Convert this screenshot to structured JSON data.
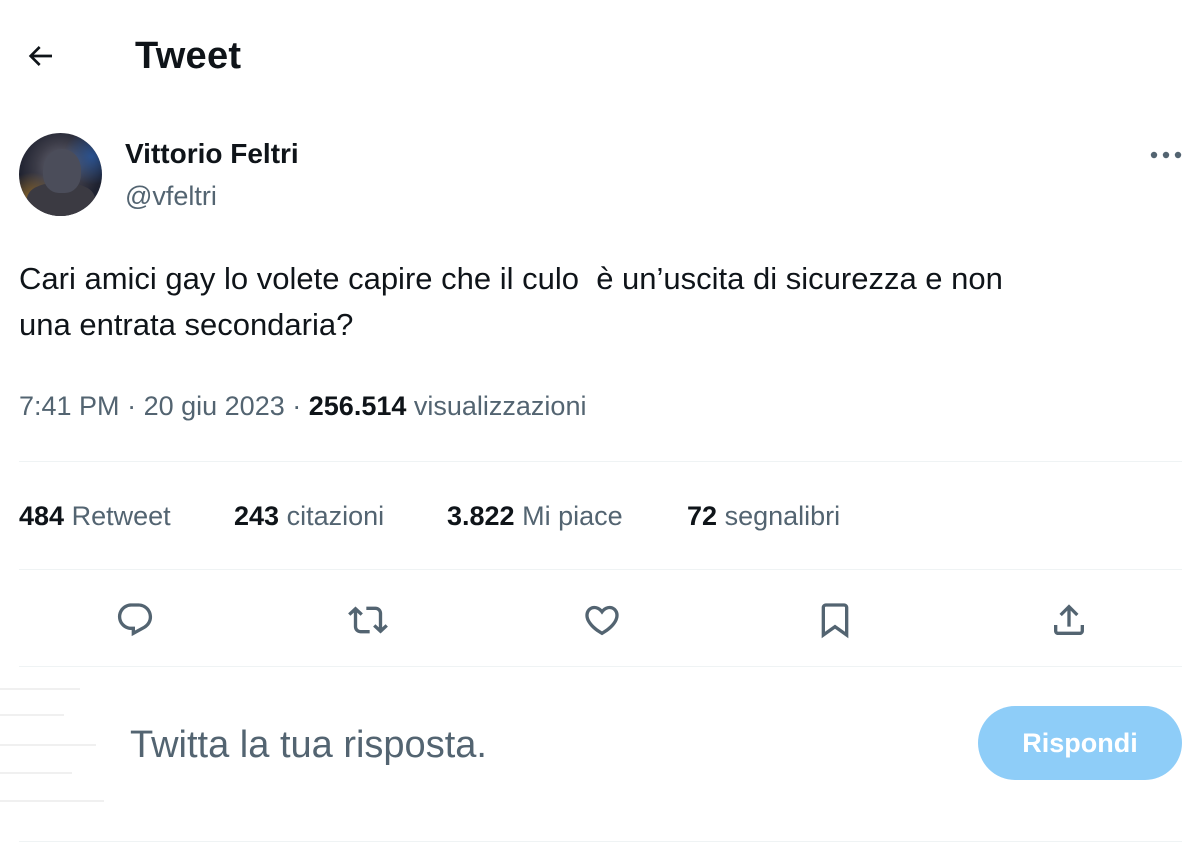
{
  "header": {
    "title": "Tweet",
    "back_icon": "arrow-left-icon"
  },
  "author": {
    "name": "Vittorio Feltri",
    "handle": "@vfeltri",
    "more_icon": "more-horizontal-icon"
  },
  "tweet": {
    "text": "Cari amici gay lo volete capire che il culo  è un’uscita di sicurezza e non\nuna entrata secondaria?",
    "time": "7:41 PM",
    "date": "20 giu 2023",
    "separator": "·",
    "views_count": "256.514",
    "views_label": "visualizzazioni"
  },
  "stats": [
    {
      "count": "484",
      "label": "Retweet"
    },
    {
      "count": "243",
      "label": "citazioni"
    },
    {
      "count": "3.822",
      "label": "Mi piace"
    },
    {
      "count": "72",
      "label": "segnalibri"
    }
  ],
  "actions": [
    "reply-icon",
    "retweet-icon",
    "like-icon",
    "bookmark-icon",
    "share-icon"
  ],
  "reply_box": {
    "placeholder": "Twitta la tua risposta.",
    "button_label": "Rispondi"
  },
  "colors": {
    "text": "#0f1419",
    "secondary": "#536471",
    "divider": "#eff3f4",
    "reply_button": "#8ecdf8"
  }
}
